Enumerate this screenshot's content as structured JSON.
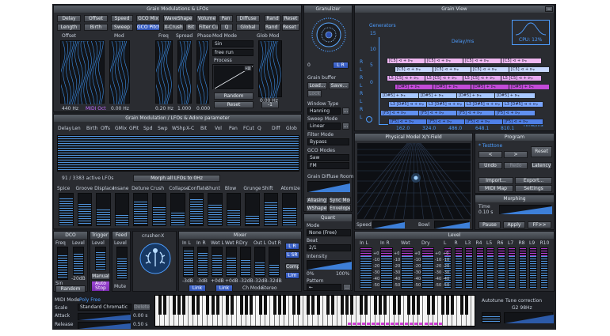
{
  "grain_mods": {
    "title": "Grain Modulations & LFOs",
    "row1": [
      "Delay",
      "Offset",
      "Speed",
      "GCO Mix",
      "WaveShape",
      "Volume",
      "Pan",
      "Diffuse",
      "Rand",
      "Reset"
    ],
    "row2": [
      "Length",
      "Birth",
      "Sweep",
      "GCO Pitch",
      "X-Crush",
      "Bit",
      "Filter Cut",
      "Q",
      "Global",
      "Rand T",
      "Reset T"
    ],
    "labels": [
      "Offset",
      "Mod",
      "Freq",
      "Spread",
      "Phase",
      "Mod Mode",
      "Glob Mod"
    ],
    "mod_mode_values": [
      "Sin",
      "free run"
    ],
    "process_label": "Process",
    "random_btn": "Random",
    "reset_btn": "Reset",
    "values": [
      "440 Hz",
      "MIDI Oct",
      "0.00 Hz",
      "0.20 Hz",
      "1.000",
      "0.000",
      "0.00 Hz"
    ],
    "minus_one_a": "-1",
    "minus_one_b": "-1"
  },
  "granulizer": {
    "title": "Granulizer",
    "knob_value": "0",
    "knob_lr": "L R",
    "buffer_label": "Grain buffer",
    "load": "Load...",
    "save": "Save...",
    "lock": "Lock",
    "window_type_label": "Window Type",
    "window_type": "Hanning",
    "sweep_mode_label": "Sweep Mode",
    "sweep_mode": "Linear",
    "filter_mode_label": "Filter Mode",
    "filter_mode": "Bypass",
    "gco_modes_label": "GCO Modes",
    "gco_mode_1": "Saw",
    "gco_mode_2": "FM",
    "diffuse_room_label": "Grain Diffuse Room",
    "aliasing": "Aliasing",
    "sync_mod": "Sync Mod",
    "wshape": "WShape",
    "envelope": "Envelope"
  },
  "grain_view": {
    "title": "Grain View",
    "generators_label": "Generators",
    "delay_label": "Delay/ms",
    "cpu_label": "CPU: 12%",
    "y_ticks": [
      "15",
      "10",
      "5",
      "0"
    ],
    "x_ticks": [
      "162.0",
      "324.0",
      "486.0",
      "648.1",
      "810.1"
    ],
    "x_unit": "Time/ms",
    "lr": [
      "R",
      "L",
      "R",
      "L",
      "R",
      "L",
      "R",
      "L"
    ],
    "bars": [
      {
        "text": "[C5] ⊲ + ⊳ᵦ",
        "color": "#f0b8f0"
      },
      {
        "text": "[C5] ⊲ + ⊳ᵦ",
        "color": "#c8d8ff"
      },
      {
        "text": "L5 [C5] ⊲ + ⊳ᵦ",
        "color": "#e6a8f0"
      },
      {
        "text": "[D#5] + ⊳ᵦ",
        "color": "#c24ad8"
      },
      {
        "text": "[D#5] + ⊳ᵦ",
        "color": "#a8c8ff"
      },
      {
        "text": "L3 [D#5] ⊲ + ⊳ᵦ",
        "color": "#7aa6ff"
      },
      {
        "text": "[F5] ⊲ + ⊳ᵦ",
        "color": "#6090f0"
      },
      {
        "text": "[F5] ⊲ + ⊳ᵦ",
        "color": "#4f7fe6"
      }
    ]
  },
  "mod_lfos": {
    "title": "Grain Modulation / LFOs & Adore parameter",
    "columns": [
      "Delay",
      "Len",
      "Birth",
      "Offs",
      "GMix",
      "GPit",
      "Spd",
      "Swp",
      "WShp",
      "X-C",
      "Bit",
      "Vol",
      "Pan",
      "FCut",
      "Q",
      "Diff",
      "Glob"
    ],
    "active_lfos": "91 / 3383 active LFOs",
    "morph_btn": "Morph all LFOs to 0Hz",
    "effects": [
      "Spice",
      "Groove",
      "Displace",
      "Insane",
      "Detune",
      "Crush",
      "Collapse",
      "Conflate",
      "Shunt",
      "Blow",
      "Grunge",
      "Shift",
      "Atomize"
    ]
  },
  "xy_field": {
    "title": "Physical Model X/Y-Field",
    "speed_label": "Speed",
    "bowl_label": "Bowl"
  },
  "program": {
    "title": "Program",
    "preset": "* Testtone",
    "reset": "Reset",
    "undo": "Undo",
    "redo": "Redo",
    "latency": "Latency",
    "import": "Import...",
    "export": "Export...",
    "midi_map": "MIDI Map",
    "settings": "Settings",
    "arrow_left": "<",
    "arrow_right": ">"
  },
  "morphing": {
    "title": "Morphing",
    "time_label": "Time",
    "time_value": "0.10 s",
    "pause": "Pause",
    "apply": "Apply",
    "ff": "FF>>"
  },
  "quant": {
    "title": "Quant",
    "mode_label": "Mode",
    "mode_value": "None (Free)",
    "beat_label": "Beat",
    "beat_value": "2/1",
    "intensity_label": "Intensity",
    "min": "0%",
    "max": "100%",
    "pattern_label": "Pattern"
  },
  "gco": {
    "dco": "DCO",
    "freq": "Freq",
    "level": "Level",
    "sin": "Sin",
    "db": "-20dB",
    "random": "Random"
  },
  "trigger": {
    "title": "Trigger",
    "level": "Level",
    "manual": "Manual",
    "auto_stop": "Auto Stop"
  },
  "feed": {
    "title": "Feed",
    "level": "Level",
    "mute": "Mute"
  },
  "crusher": {
    "title": "crusher-X"
  },
  "mixer": {
    "title": "Mixer",
    "cols": [
      "In L",
      "In R",
      "Wet L",
      "Wet R",
      "Dry",
      "Out L",
      "Out R"
    ],
    "values": [
      "-3dB",
      "-3dB",
      "+0dB",
      "+0dB",
      "-32dB",
      "-32dB",
      "-32dB"
    ],
    "link1": "Link",
    "link2": "Link",
    "ch_mode_label": "Ch Mode",
    "ch_mode": "Stereo",
    "lr_btn": "L R",
    "lsr_btn": "L SR",
    "comp_btn": "Comp",
    "lim_btn": "Lim"
  },
  "level": {
    "title": "Level",
    "cols": [
      "In L",
      "In R",
      "Wet",
      "Dry",
      "L",
      "R",
      "L3",
      "R4",
      "L5",
      "R6",
      "L7",
      "R8",
      "L9",
      "R10"
    ],
    "scale": [
      "+0",
      "-10",
      "-20",
      "-30",
      "-40",
      "-50"
    ]
  },
  "bottom": {
    "midi_mode_label": "MIDI Mode",
    "midi_mode": "Poly Free",
    "scale_label": "Scale",
    "scale_value": "Standard Chromatic",
    "delete": "Delete",
    "attack_label": "Attack",
    "attack_value": "0.00 s",
    "release_label": "Release",
    "release_value": "0.50 s",
    "autotune_label": "Autotune",
    "tune_label": "Tune correction",
    "tune_value": "G2 98Hz"
  }
}
